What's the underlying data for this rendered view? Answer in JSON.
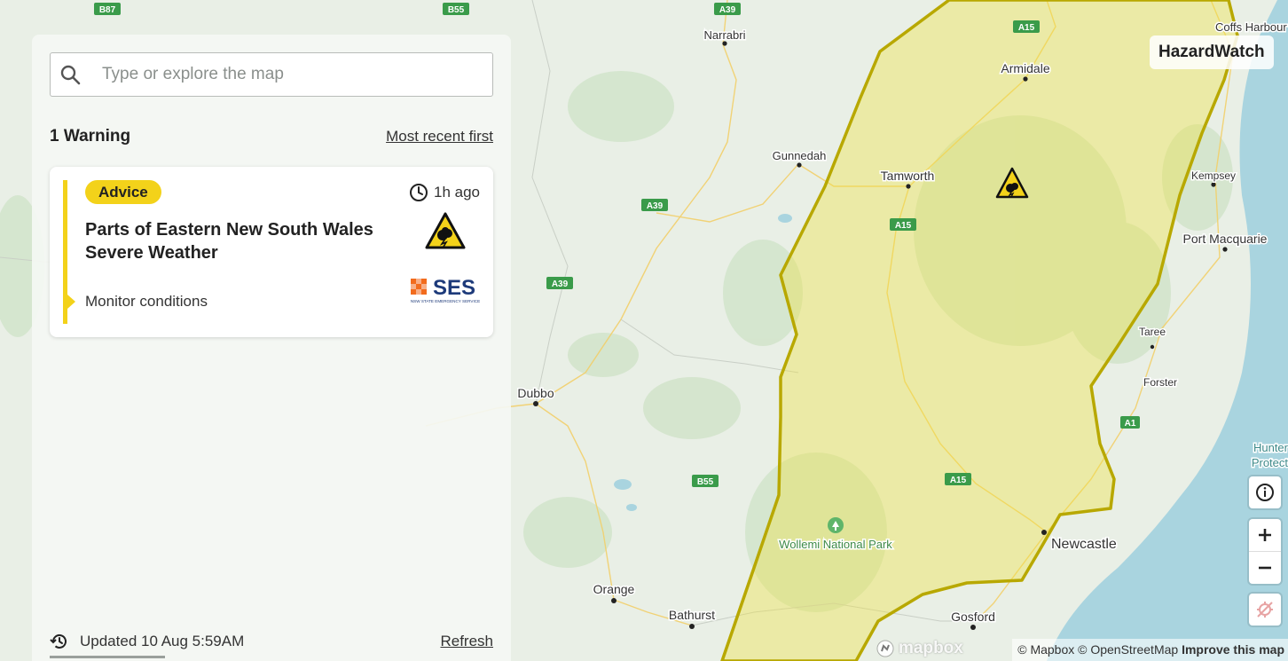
{
  "search": {
    "placeholder": "Type or explore the map"
  },
  "list": {
    "count_label": "1 Warning",
    "sort_label": "Most recent first"
  },
  "warning": {
    "level": "Advice",
    "time": "1h ago",
    "title_line1": "Parts of Eastern New South Wales",
    "title_line2": "Severe Weather",
    "action": "Monitor conditions",
    "agency_logo_text": "SES",
    "agency_logo_subtext": "NSW STATE EMERGENCY SERVICE",
    "hazard_icon": "severe-weather-icon",
    "level_color": "#f3d21a"
  },
  "footer": {
    "updated": "Updated 10 Aug 5:59AM",
    "refresh_label": "Refresh"
  },
  "brand": "HazardWatch",
  "map": {
    "towns": {
      "narrabri": "Narrabri",
      "gunnedah": "Gunnedah",
      "tamworth": "Tamworth",
      "armidale": "Armidale",
      "coffs": "Coffs Harbour",
      "kempsey": "Kempsey",
      "port_macquarie": "Port Macquarie",
      "taree": "Taree",
      "forster": "Forster",
      "dubbo": "Dubbo",
      "orange": "Orange",
      "bathurst": "Bathurst",
      "gosford": "Gosford",
      "newcastle": "Newcastle",
      "wollemi": "Wollemi National Park",
      "hunter1": "Hunter",
      "hunter2": "Protect"
    },
    "roads": {
      "b87": "B87",
      "b55_top": "B55",
      "a39_top": "A39",
      "a15_top": "A15",
      "a39_mid": "A39",
      "a15_mid": "A15",
      "a39_low": "A39",
      "a1": "A1",
      "b55_low": "B55",
      "a15_low": "A15"
    }
  },
  "attribution": {
    "mapbox": "© Mapbox",
    "osm": "© OpenStreetMap",
    "improve": "Improve this map",
    "logo": "mapbox"
  },
  "colors": {
    "warning_area_fill": "#f0e23f",
    "warning_area_stroke": "#b8a800",
    "sea": "#a9d4df",
    "land": "#e8efe6"
  }
}
